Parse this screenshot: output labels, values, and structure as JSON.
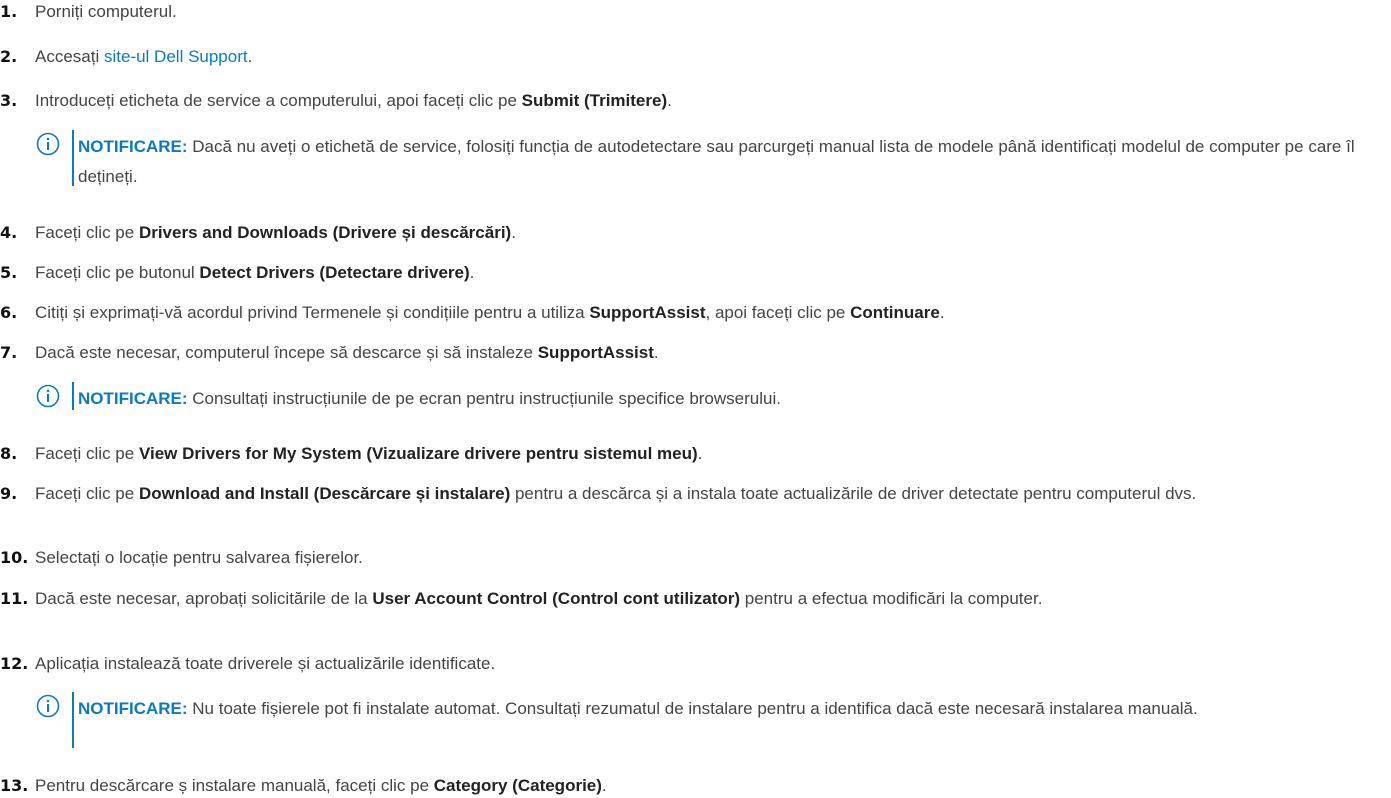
{
  "steps": [
    {
      "num": "1.",
      "parts": [
        {
          "t": "Porniți computerul."
        }
      ]
    },
    {
      "num": "2.",
      "parts": [
        {
          "t": "Accesați "
        },
        {
          "t": "site-ul Dell Support",
          "link": true
        },
        {
          "t": "."
        }
      ]
    },
    {
      "num": "3.",
      "parts": [
        {
          "t": "Introduceți eticheta de service a computerului, apoi faceți clic pe "
        },
        {
          "t": "Submit (Trimitere)",
          "b": true
        },
        {
          "t": "."
        }
      ]
    },
    {
      "num": "4.",
      "parts": [
        {
          "t": "Faceți clic pe "
        },
        {
          "t": "Drivers and Downloads (Drivere și descărcări)",
          "b": true
        },
        {
          "t": "."
        }
      ]
    },
    {
      "num": "5.",
      "parts": [
        {
          "t": "Faceți clic pe butonul "
        },
        {
          "t": "Detect Drivers (Detectare drivere)",
          "b": true
        },
        {
          "t": "."
        }
      ]
    },
    {
      "num": "6.",
      "parts": [
        {
          "t": "Citiți și exprimați-vă acordul privind Termenele și condițiile pentru a utiliza "
        },
        {
          "t": "SupportAssist",
          "b": true
        },
        {
          "t": ", apoi faceți clic pe "
        },
        {
          "t": "Continuare",
          "b": true
        },
        {
          "t": "."
        }
      ]
    },
    {
      "num": "7.",
      "parts": [
        {
          "t": "Dacă este necesar, computerul începe să descarce și să instaleze "
        },
        {
          "t": "SupportAssist",
          "b": true
        },
        {
          "t": "."
        }
      ]
    },
    {
      "num": "8.",
      "parts": [
        {
          "t": "Faceți clic pe "
        },
        {
          "t": "View Drivers for My System (Vizualizare drivere pentru sistemul meu)",
          "b": true
        },
        {
          "t": "."
        }
      ]
    },
    {
      "num": "9.",
      "parts": [
        {
          "t": "Faceți clic pe "
        },
        {
          "t": "Download and Install (Descărcare și instalare)",
          "b": true
        },
        {
          "t": " pentru a descărca și a instala toate actualizările de driver detectate pentru computerul dvs."
        }
      ]
    },
    {
      "num": "10.",
      "parts": [
        {
          "t": "Selectați o locație pentru salvarea fișierelor."
        }
      ]
    },
    {
      "num": "11.",
      "parts": [
        {
          "t": "Dacă este necesar, aprobați solicitările de la "
        },
        {
          "t": "User Account Control (Control cont utilizator)",
          "b": true
        },
        {
          "t": " pentru a efectua modificări la computer."
        }
      ]
    },
    {
      "num": "12.",
      "parts": [
        {
          "t": "Aplicația instalează toate driverele și actualizările identificate."
        }
      ]
    },
    {
      "num": "13.",
      "parts": [
        {
          "t": "Pentru descărcare ș instalare manuală, faceți clic pe "
        },
        {
          "t": "Category (Categorie)",
          "b": true
        },
        {
          "t": "."
        }
      ]
    }
  ],
  "notes": [
    {
      "label": "NOTIFICARE:",
      "text": " Dacă nu aveți o etichetă de service, folosiți funcția de autodetectare sau parcurgeți manual lista de modele până identificați modelul de computer pe care îl dețineți."
    },
    {
      "label": "NOTIFICARE:",
      "text": " Consultați instrucțiunile de pe ecran pentru instrucțiunile specifice browserului."
    },
    {
      "label": "NOTIFICARE:",
      "text": " Nu toate fișierele pot fi instalate automat. Consultați rezumatul de instalare pentru a identifica dacă este necesară instalarea manuală."
    }
  ],
  "colors": {
    "accent": "#0a7bc1",
    "text": "#444444",
    "bold": "#222222"
  },
  "icons": {
    "note": "info-circle-icon"
  }
}
